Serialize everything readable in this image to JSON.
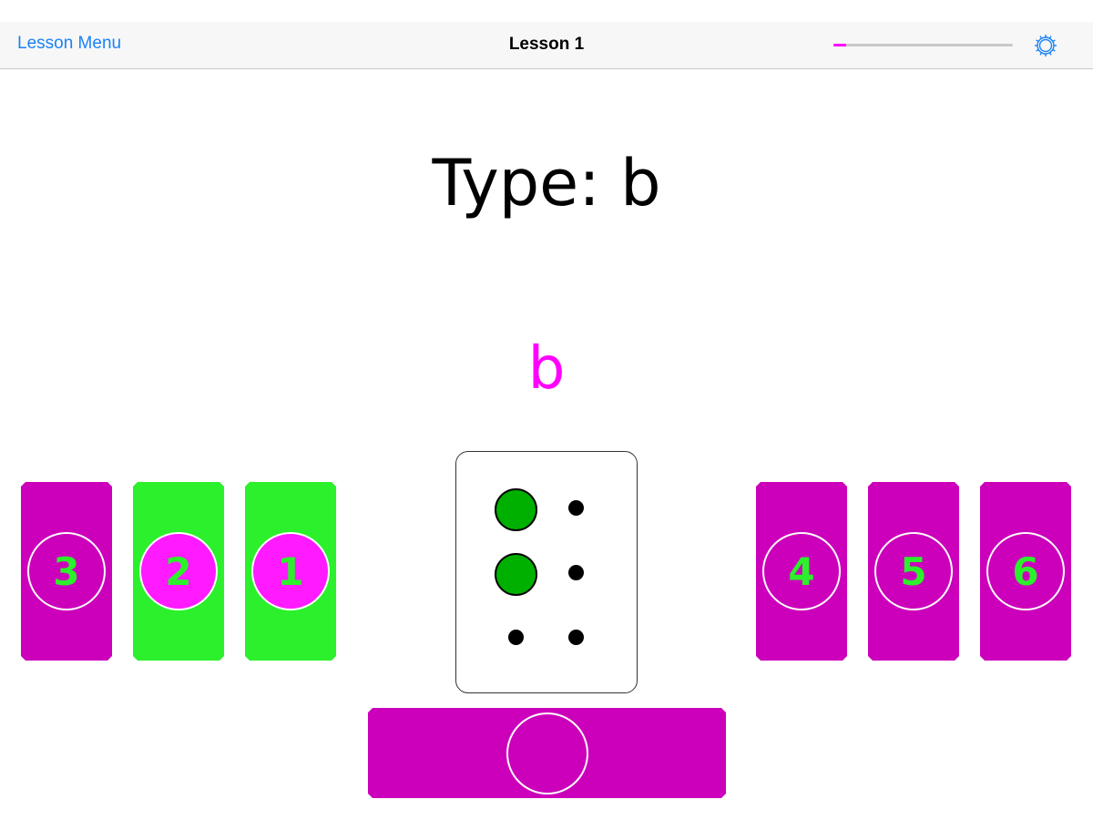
{
  "navbar": {
    "back_label": "Lesson Menu",
    "title": "Lesson 1",
    "progress_fraction": 0.07,
    "settings_icon": "gear-icon"
  },
  "prompt": {
    "text": "Type: b"
  },
  "typed": {
    "text": "b"
  },
  "keys": {
    "left": [
      {
        "label": "3",
        "active": false
      },
      {
        "label": "2",
        "active": true
      },
      {
        "label": "1",
        "active": true
      }
    ],
    "right": [
      {
        "label": "4",
        "active": false
      },
      {
        "label": "5",
        "active": false
      },
      {
        "label": "6",
        "active": false
      }
    ]
  },
  "braille_cell": {
    "raised_dots": [
      1,
      2
    ]
  },
  "colors": {
    "key_inactive": "#cc00bb",
    "key_active": "#2cf02c",
    "accent": "#ff00ff",
    "dot_raised": "#00b000",
    "link": "#1a82f7"
  }
}
